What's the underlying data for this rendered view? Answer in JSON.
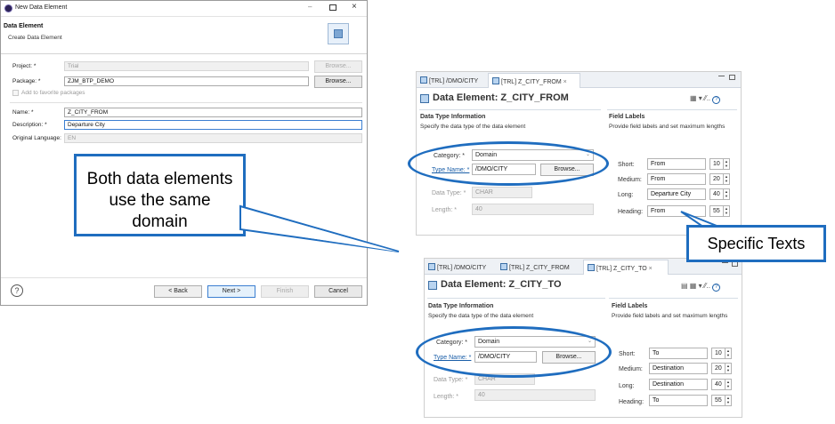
{
  "wizard": {
    "window_title": "New Data Element",
    "header_title": "Data Element",
    "header_subtitle": "Create Data Element",
    "project_label": "Project: *",
    "project_value": "Trial",
    "browse_project": "Browse...",
    "package_label": "Package: *",
    "package_value": "ZJM_BTP_DEMO",
    "browse_package": "Browse...",
    "favorite_label": "Add to favorite packages",
    "name_label": "Name: *",
    "name_value": "Z_CITY_FROM",
    "description_label": "Description: *",
    "description_value": "Departure City",
    "orig_lang_label": "Original Language:",
    "orig_lang_value": "EN",
    "help_icon": "?",
    "back_label": "< Back",
    "next_label": "Next >",
    "finish_label": "Finish",
    "cancel_label": "Cancel"
  },
  "callout_left": "Both data elements use the same domain",
  "callout_right": "Specific Texts",
  "editor_from": {
    "tabs": [
      "[TRL] /DMO/CITY",
      "[TRL] Z_CITY_FROM"
    ],
    "title": "Data Element: Z_CITY_FROM",
    "dti_title": "Data Type Information",
    "dti_desc": "Specify the data type of the data element",
    "category_label": "Category: *",
    "category_value": "Domain",
    "typename_label": "Type Name: *",
    "typename_value": "/DMO/CITY",
    "browse": "Browse...",
    "datatype_label": "Data Type: *",
    "datatype_value": "CHAR",
    "length_label": "Length: *",
    "length_value": "40",
    "fl_title": "Field Labels",
    "fl_desc": "Provide field labels and set maximum lengths",
    "short_label": "Short:",
    "short_value": "From",
    "short_len": "10",
    "medium_label": "Medium:",
    "medium_value": "From",
    "medium_len": "20",
    "long_label": "Long:",
    "long_value": "Departure City",
    "long_len": "40",
    "heading_label": "Heading:",
    "heading_value": "From",
    "heading_len": "55"
  },
  "editor_to": {
    "tabs": [
      "[TRL] /DMO/CITY",
      "[TRL] Z_CITY_FROM",
      "[TRL] Z_CITY_TO"
    ],
    "title": "Data Element: Z_CITY_TO",
    "dti_title": "Data Type Information",
    "dti_desc": "Specify the data type of the data element",
    "category_label": "Category: *",
    "category_value": "Domain",
    "typename_label": "Type Name: *",
    "typename_value": "/DMO/CITY",
    "browse": "Browse...",
    "datatype_label": "Data Type: *",
    "datatype_value": "CHAR",
    "length_label": "Length: *",
    "length_value": "40",
    "fl_title": "Field Labels",
    "fl_desc": "Provide field labels and set maximum lengths",
    "short_label": "Short:",
    "short_value": "To",
    "short_len": "10",
    "medium_label": "Medium:",
    "medium_value": "Destination",
    "medium_len": "20",
    "long_label": "Long:",
    "long_value": "Destination",
    "long_len": "40",
    "heading_label": "Heading:",
    "heading_value": "To",
    "heading_len": "55"
  },
  "colors": {
    "accent": "#1f6dbf",
    "link": "#1a5ea8"
  }
}
